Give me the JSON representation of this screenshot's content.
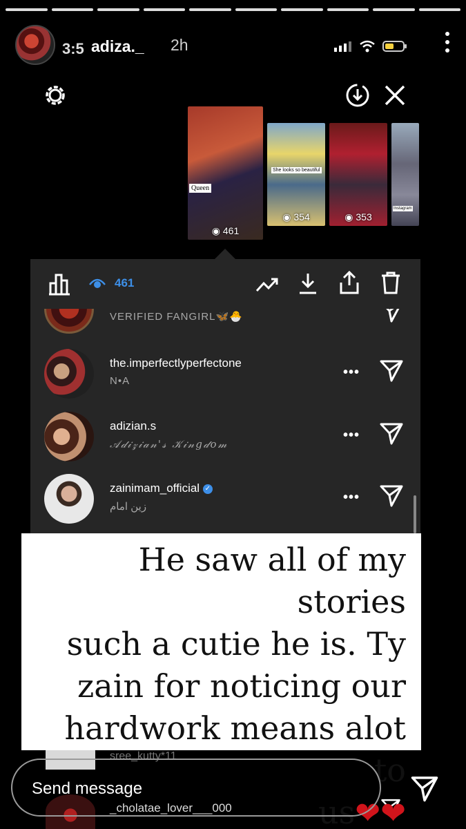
{
  "story": {
    "progress_segments": 10,
    "overlay_time": "3:5",
    "username": "adiza._",
    "posted": "2h"
  },
  "shot": {
    "thumbnails": [
      {
        "count": "461",
        "label": "Queen"
      },
      {
        "count": "354",
        "label": "She looks so beautiful"
      },
      {
        "count": "353",
        "label": ""
      },
      {
        "count": "",
        "label": "Instagram"
      }
    ],
    "views_count": "461"
  },
  "viewers": [
    {
      "username": "",
      "subtitle": "VERIFIED FANGIRL🦋🐣"
    },
    {
      "username": "the.imperfectlyperfectone",
      "subtitle": "N•A"
    },
    {
      "username": "adizian.s",
      "subtitle": "𝒜𝒹𝒾𝓏𝒾𝒶𝓃'𝓈 𝒦𝒾𝓃𝑔𝒹𝑜𝓂"
    },
    {
      "username": "zainimam_official",
      "subtitle": "زین امام",
      "verified": true
    }
  ],
  "caption": {
    "line1": "He saw all of my stories",
    "line2": "such a cutie he is. Ty",
    "line3": "zain for noticing our",
    "line4": "hardwork means alot to",
    "line5": "us",
    "hearts": "❤❤"
  },
  "below": {
    "row1": "sree_kutty*11",
    "row2": "_cholatae_lover___000"
  },
  "message": {
    "placeholder": "Send message"
  },
  "colors": {
    "accent": "#3d8fe8",
    "panel": "#262626",
    "heart": "#d0141b"
  }
}
